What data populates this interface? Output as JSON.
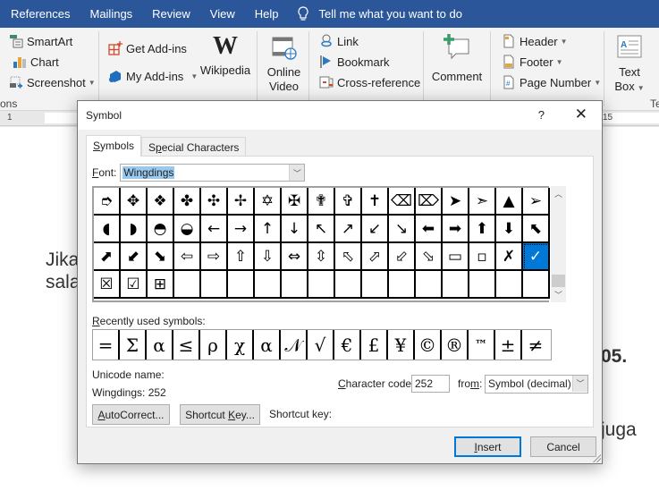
{
  "menubar": {
    "tabs": [
      "References",
      "Mailings",
      "Review",
      "View",
      "Help"
    ],
    "tell_me": "Tell me what you want to do"
  },
  "ribbon": {
    "illustrations": {
      "smartart": "SmartArt",
      "chart": "Chart",
      "screenshot": "Screenshot",
      "group_label": "ons"
    },
    "addins": {
      "get_addins": "Get Add-ins",
      "my_addins": "My Add-ins",
      "wikipedia": "Wikipedia",
      "wiki_glyph": "W"
    },
    "media": {
      "online_video_line1": "Online",
      "online_video_line2": "Video"
    },
    "links": {
      "link": "Link",
      "bookmark": "Bookmark",
      "cross_reference": "Cross-reference"
    },
    "comments": {
      "comment": "Comment"
    },
    "header_footer": {
      "header": "Header",
      "footer": "Footer",
      "page_number": "Page Number"
    },
    "text": {
      "text_box_line1": "Text",
      "text_box_line2": "Box",
      "group_label": "Te"
    }
  },
  "ruler": {
    "left_num": "1",
    "right_num": "15"
  },
  "document": {
    "line1": "Jika",
    "line2": "sala",
    "right1": "05.",
    "right2": "juga"
  },
  "dialog": {
    "title": "Symbol",
    "help": "?",
    "close": "✕",
    "tabs": [
      {
        "label_pre": "",
        "label_u": "S",
        "label_post": "ymbols",
        "active": true
      },
      {
        "label_pre": "S",
        "label_u": "p",
        "label_post": "ecial Characters",
        "active": false
      }
    ],
    "font_label_u": "F",
    "font_label_rest": "ont:",
    "font_value": "Wingdings",
    "symbol_grid": [
      [
        "➮",
        "✥",
        "❖",
        "✤",
        "✣",
        "✢",
        "✡",
        "✠",
        "✟",
        "✞",
        "✝",
        "⌫",
        "⌦",
        "➤",
        "➣",
        "▲",
        "➢"
      ],
      [
        "◖",
        "◗",
        "◓",
        "◒",
        "←",
        "→",
        "↑",
        "↓",
        "↖",
        "↗",
        "↙",
        "↘",
        "⬅",
        "➡",
        "⬆",
        "⬇",
        "⬉"
      ],
      [
        "⬈",
        "⬋",
        "⬊",
        "⇦",
        "⇨",
        "⇧",
        "⇩",
        "⇔",
        "⇳",
        "⬁",
        "⬀",
        "⬃",
        "⬂",
        "▭",
        "▫",
        "✗",
        "✓"
      ],
      [
        "☒",
        "☑",
        "⊞",
        "",
        "",
        "",
        "",
        "",
        "",
        "",
        "",
        "",
        "",
        "",
        "",
        "",
        ""
      ]
    ],
    "selected_index": [
      2,
      16
    ],
    "recent_label_u": "R",
    "recent_label_rest": "ecently used symbols:",
    "recent_symbols": [
      "=",
      "Σ",
      "α",
      "≤",
      "ρ",
      "χ",
      "α",
      "𝒩",
      "√",
      "€",
      "£",
      "¥",
      "©",
      "®",
      "™",
      "±",
      "≠"
    ],
    "unicode_name_label": "Unicode name:",
    "unicode_name_value": "Wingdings: 252",
    "autocorrect_u": "A",
    "autocorrect_rest": "utoCorrect...",
    "shortcut_key_pre": "Shortcut ",
    "shortcut_key_u": "K",
    "shortcut_key_post": "ey...",
    "shortcut_key_label": "Shortcut key:",
    "char_code_u": "C",
    "char_code_rest": "haracter code:",
    "char_code_value": "252",
    "from_pre": "fro",
    "from_u": "m",
    "from_post": ":",
    "from_value": "Symbol (decimal)",
    "insert_u": "I",
    "insert_rest": "nsert",
    "cancel": "Cancel"
  },
  "colors": {
    "brand": "#2b579a",
    "selection": "#0078d7",
    "highlight": "#99c9ef"
  }
}
